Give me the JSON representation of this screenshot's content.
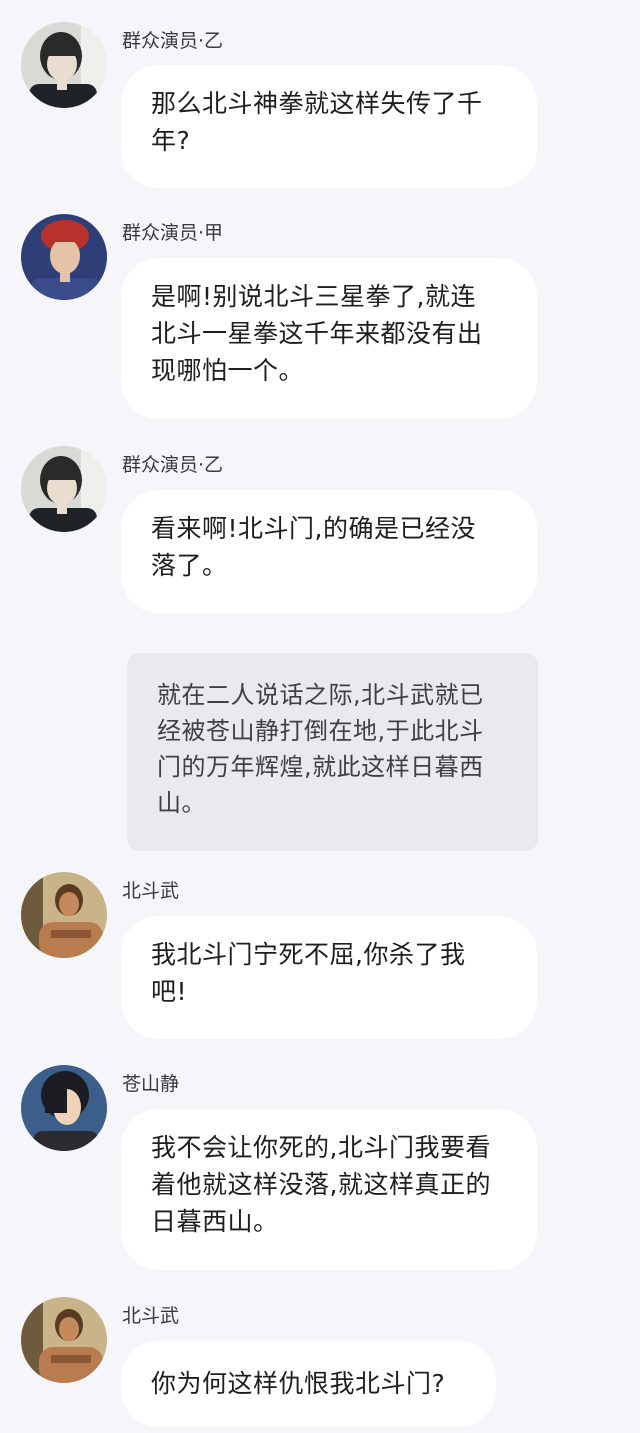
{
  "messages": [
    {
      "speaker": "群众演员·乙",
      "avatar": "student-avatar-icon",
      "text": "那么北斗神拳就这样失传了千年?"
    },
    {
      "speaker": "群众演员·甲",
      "avatar": "red-hair-avatar-icon",
      "text": "是啊!别说北斗三星拳了,就连北斗一星拳这千年来都没有出现哪怕一个。"
    },
    {
      "speaker": "群众演员·乙",
      "avatar": "student-avatar-icon",
      "text": "看来啊!北斗门,的确是已经没落了。"
    },
    {
      "speaker": "北斗武",
      "avatar": "fighter-avatar-icon",
      "text": "我北斗门宁死不屈,你杀了我吧!"
    },
    {
      "speaker": "苍山静",
      "avatar": "dark-hair-avatar-icon",
      "text": "我不会让你死的,北斗门我要看着他就这样没落,就这样真正的日暮西山。"
    },
    {
      "speaker": "北斗武",
      "avatar": "fighter-avatar-icon",
      "text": "你为何这样仇恨我北斗门?"
    }
  ],
  "narration": "就在二人说话之际,北斗武就已经被苍山静打倒在地,于此北斗门的万年辉煌,就此这样日暮西山。",
  "colors": {
    "background": "#f5f5fa",
    "bubble": "#ffffff",
    "narration_bg": "#e9e9ee"
  }
}
